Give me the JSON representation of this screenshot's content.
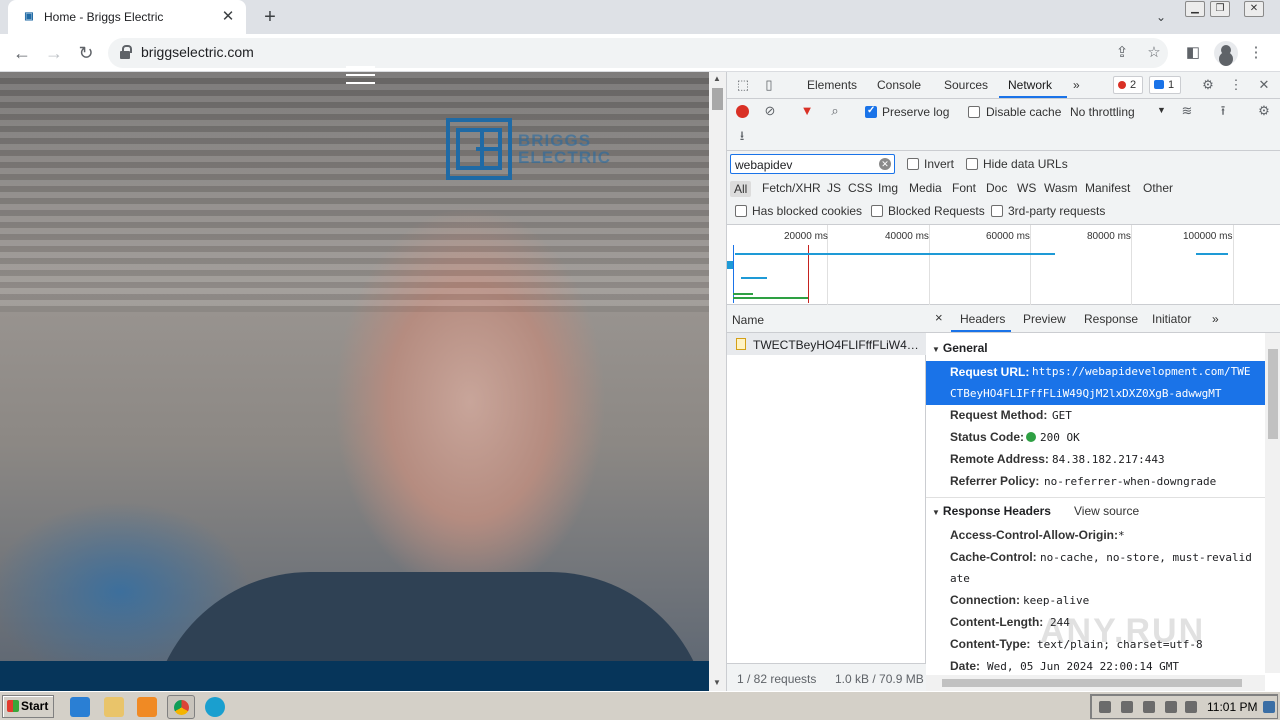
{
  "browser": {
    "tab_title": "Home - Briggs Electric",
    "tab_favicon": "briggs-favicon",
    "url": "briggselectric.com",
    "new_tab_symbol": "+",
    "tab_search_symbol": "⌄"
  },
  "page": {
    "logo_text_line1": "BRIGGS",
    "logo_text_line2": "ELECTRIC",
    "brand_color": "#1f6aa5"
  },
  "devtools": {
    "tabs": [
      "Elements",
      "Console",
      "Sources",
      "Network"
    ],
    "active_tab": "Network",
    "more_tabs": "»",
    "error_count": "2",
    "message_count": "1",
    "toolbar": {
      "preserve_log": "Preserve log",
      "preserve_log_checked": true,
      "disable_cache": "Disable cache",
      "throttling": "No throttling"
    },
    "filter": {
      "value": "webapidev",
      "invert": "Invert",
      "hide_data_urls": "Hide data URLs",
      "types": [
        "All",
        "Fetch/XHR",
        "JS",
        "CSS",
        "Img",
        "Media",
        "Font",
        "Doc",
        "WS",
        "Wasm",
        "Manifest",
        "Other"
      ],
      "active_type": "All",
      "has_blocked_cookies": "Has blocked cookies",
      "blocked_requests": "Blocked Requests",
      "third_party": "3rd-party requests"
    },
    "timeline_ticks": [
      "20000 ms",
      "40000 ms",
      "60000 ms",
      "80000 ms",
      "100000 ms"
    ],
    "name_column": "Name",
    "request_name": "TWECTBeyHO4FLIFffFLiW49Q...",
    "status_requests": "1 / 82 requests",
    "status_size": "1.0 kB / 70.9 MB",
    "detail_tabs": [
      "Headers",
      "Preview",
      "Response",
      "Initiator"
    ],
    "detail_close": "×",
    "detail_more": "»",
    "general": {
      "title": "General",
      "request_url_key": "Request URL:",
      "request_url_line1": "https://webapidevelopment.com/TWE",
      "request_url_line2": "CTBeyHO4FLIFffFLiW49QjM2lxDXZ0XgB-adwwgMT",
      "request_method_key": "Request Method:",
      "request_method": "GET",
      "status_code_key": "Status Code:",
      "status_code": "200 OK",
      "remote_address_key": "Remote Address:",
      "remote_address": "84.38.182.217:443",
      "referrer_policy_key": "Referrer Policy:",
      "referrer_policy": "no-referrer-when-downgrade"
    },
    "response_headers": {
      "title": "Response Headers",
      "view_source": "View source",
      "acao_key": "Access-Control-Allow-Origin:",
      "acao": "*",
      "cache_control_key": "Cache-Control:",
      "cache_control_line1": "no-cache, no-store, must-revalid",
      "cache_control_line2": "ate",
      "connection_key": "Connection:",
      "connection": "keep-alive",
      "content_length_key": "Content-Length:",
      "content_length": "244",
      "content_type_key": "Content-Type:",
      "content_type": "text/plain; charset=utf-8",
      "date_key": "Date:",
      "date": "Wed, 05 Jun 2024 22:00:14 GMT"
    }
  },
  "taskbar": {
    "start": "Start",
    "clock": "11:01 PM"
  },
  "watermark": "ANY.RUN"
}
